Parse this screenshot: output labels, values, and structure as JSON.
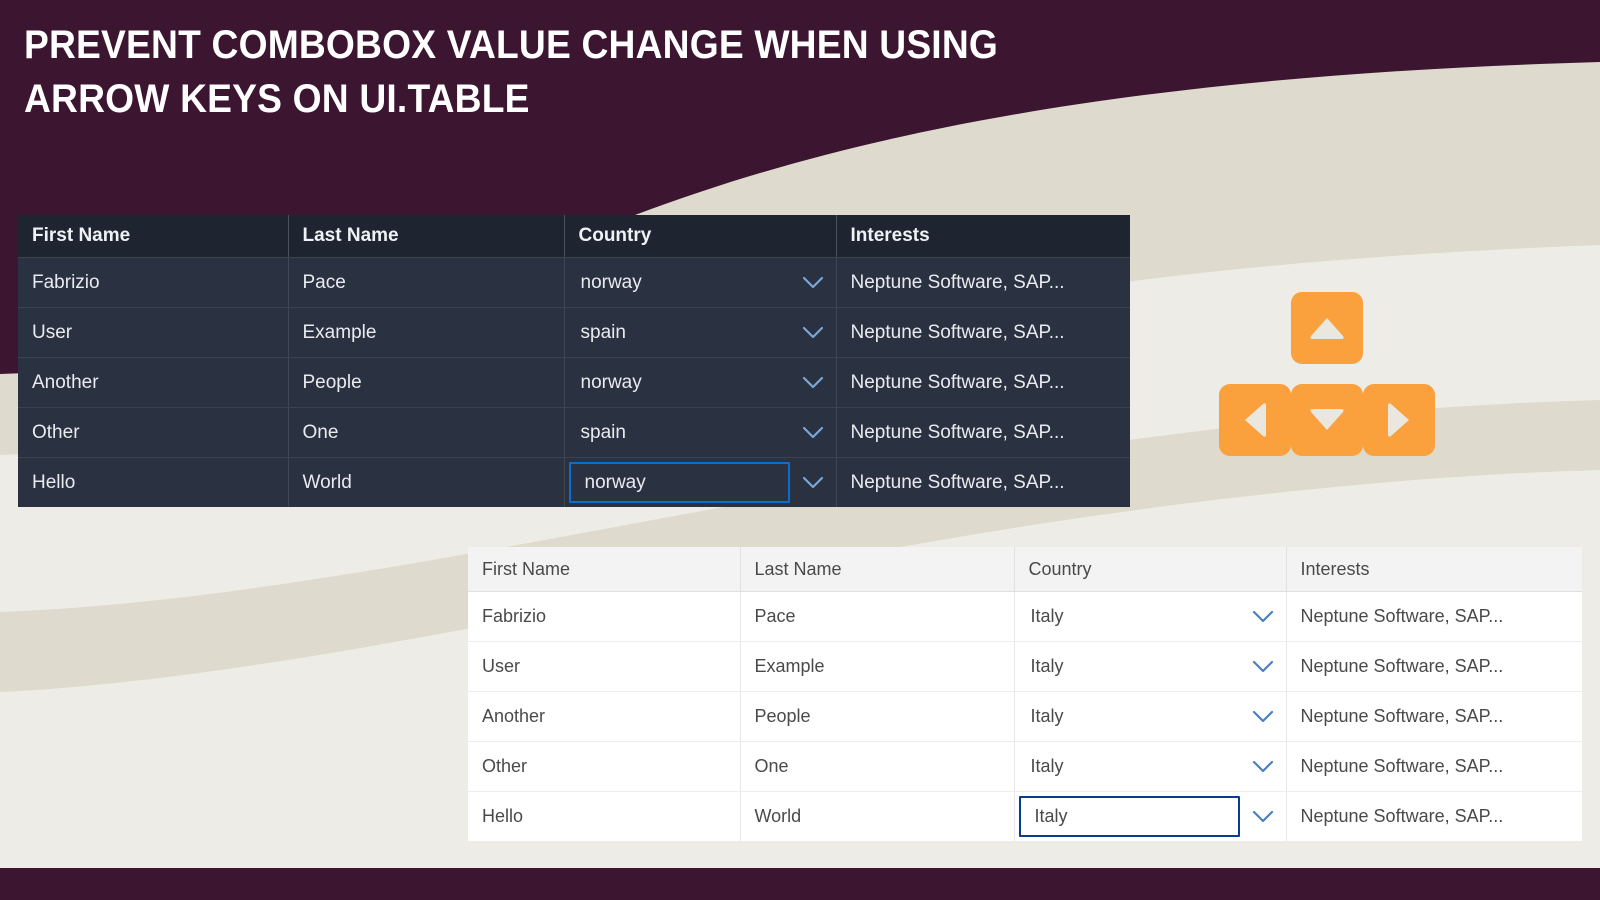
{
  "page": {
    "title_line1": "Prevent Combobox Value Change When Using",
    "title_line2": "Arrow Keys on UI.Table",
    "title_full": "PREVENT COMBOBOX VALUE CHANGE WHEN USING ARROW KEYS ON UI.TABLE"
  },
  "colors": {
    "header_purple": "#3c1531",
    "footer_purple": "#3c1531",
    "page_background": "#eeece7",
    "band_beige": "#dedacd",
    "key_orange": "#faa03c",
    "key_glyph": "#eae7de",
    "dark_table_bg": "#2a3140",
    "dark_table_header_bg": "#1f2530",
    "dark_table_text": "#e8ebef",
    "light_table_bg": "#ffffff",
    "light_table_header_bg": "#f3f3f3",
    "light_table_text": "#4a4a4a",
    "focus_border_dark": "#0a6ed1",
    "focus_border_light": "#0a3b8c",
    "chevron_dark": "#7ba7d7",
    "chevron_light": "#4a7fc1"
  },
  "dark_table": {
    "columns": [
      "First Name",
      "Last Name",
      "Country",
      "Interests"
    ],
    "rows": [
      {
        "first_name": "Fabrizio",
        "last_name": "Pace",
        "country": "norway",
        "interests": "Neptune Software, SAP...",
        "focused": false
      },
      {
        "first_name": "User",
        "last_name": "Example",
        "country": "spain",
        "interests": "Neptune Software, SAP...",
        "focused": false
      },
      {
        "first_name": "Another",
        "last_name": "People",
        "country": "norway",
        "interests": "Neptune Software, SAP...",
        "focused": false
      },
      {
        "first_name": "Other",
        "last_name": "One",
        "country": "spain",
        "interests": "Neptune Software, SAP...",
        "focused": false
      },
      {
        "first_name": "Hello",
        "last_name": "World",
        "country": "norway",
        "interests": "Neptune Software, SAP...",
        "focused": true
      }
    ]
  },
  "light_table": {
    "columns": [
      "First Name",
      "Last Name",
      "Country",
      "Interests"
    ],
    "rows": [
      {
        "first_name": "Fabrizio",
        "last_name": "Pace",
        "country": "Italy",
        "interests": "Neptune Software, SAP...",
        "focused": false
      },
      {
        "first_name": "User",
        "last_name": "Example",
        "country": "Italy",
        "interests": "Neptune Software, SAP...",
        "focused": false
      },
      {
        "first_name": "Another",
        "last_name": "People",
        "country": "Italy",
        "interests": "Neptune Software, SAP...",
        "focused": false
      },
      {
        "first_name": "Other",
        "last_name": "One",
        "country": "Italy",
        "interests": "Neptune Software, SAP...",
        "focused": false
      },
      {
        "first_name": "Hello",
        "last_name": "World",
        "country": "Italy",
        "interests": "Neptune Software, SAP...",
        "focused": true
      }
    ]
  },
  "arrow_keys": [
    {
      "id": "up",
      "icon": "arrow-up-key-icon",
      "label": "Up arrow key"
    },
    {
      "id": "left",
      "icon": "arrow-left-key-icon",
      "label": "Left arrow key"
    },
    {
      "id": "down",
      "icon": "arrow-down-key-icon",
      "label": "Down arrow key"
    },
    {
      "id": "right",
      "icon": "arrow-right-key-icon",
      "label": "Right arrow key"
    }
  ]
}
